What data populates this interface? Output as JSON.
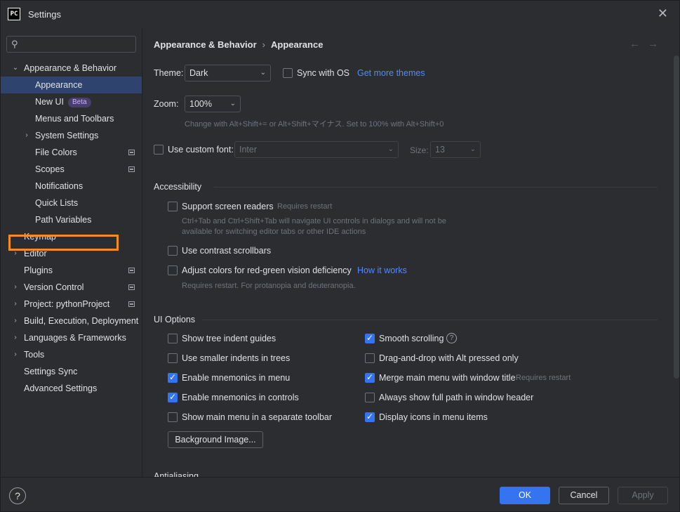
{
  "window": {
    "title": "Settings",
    "app_icon": "PC"
  },
  "search": {
    "placeholder": ""
  },
  "tree": [
    {
      "label": "Appearance & Behavior",
      "expanded": true
    },
    {
      "label": "Appearance",
      "selected": true
    },
    {
      "label": "New UI",
      "badge": "Beta"
    },
    {
      "label": "Menus and Toolbars"
    },
    {
      "label": "System Settings"
    },
    {
      "label": "File Colors"
    },
    {
      "label": "Scopes"
    },
    {
      "label": "Notifications"
    },
    {
      "label": "Quick Lists"
    },
    {
      "label": "Path Variables"
    },
    {
      "label": "Keymap"
    },
    {
      "label": "Editor"
    },
    {
      "label": "Plugins",
      "highlighted": true
    },
    {
      "label": "Version Control"
    },
    {
      "label": "Project: pythonProject"
    },
    {
      "label": "Build, Execution, Deployment"
    },
    {
      "label": "Languages & Frameworks"
    },
    {
      "label": "Tools"
    },
    {
      "label": "Settings Sync"
    },
    {
      "label": "Advanced Settings"
    }
  ],
  "breadcrumb": {
    "parent": "Appearance & Behavior",
    "sep": "›",
    "current": "Appearance"
  },
  "nav": {
    "back": "←",
    "forward": "→"
  },
  "theme": {
    "label": "Theme:",
    "value": "Dark",
    "sync_label": "Sync with OS",
    "sync_checked": false,
    "more_link": "Get more themes"
  },
  "zoom": {
    "label": "Zoom:",
    "value": "100%",
    "hint": "Change with Alt+Shift+= or Alt+Shift+マイナス. Set to 100% with Alt+Shift+0"
  },
  "font": {
    "checkbox_label": "Use custom font:",
    "checked": false,
    "value": "Inter",
    "size_label": "Size:",
    "size_value": "13"
  },
  "accessibility": {
    "title": "Accessibility",
    "screen_readers": {
      "label": "Support screen readers",
      "note": "Requires restart",
      "desc1": "Ctrl+Tab and Ctrl+Shift+Tab will navigate UI controls in dialogs and will not be",
      "desc2": "available for switching editor tabs or other IDE actions",
      "checked": false
    },
    "contrast": {
      "label": "Use contrast scrollbars",
      "checked": false
    },
    "color_def": {
      "label": "Adjust colors for red-green vision deficiency",
      "link": "How it works",
      "desc": "Requires restart. For protanopia and deuteranopia.",
      "checked": false
    }
  },
  "ui_options": {
    "title": "UI Options",
    "left": [
      {
        "label": "Show tree indent guides",
        "checked": false
      },
      {
        "label": "Use smaller indents in trees",
        "checked": false
      },
      {
        "label": "Enable mnemonics in menu",
        "checked": true
      },
      {
        "label": "Enable mnemonics in controls",
        "checked": true
      },
      {
        "label": "Show main menu in a separate toolbar",
        "checked": false
      }
    ],
    "right": [
      {
        "label": "Smooth scrolling",
        "checked": true
      },
      {
        "label": "Drag-and-drop with Alt pressed only",
        "checked": false
      },
      {
        "label": "Merge main menu with window title",
        "note": "Requires restart",
        "checked": true
      },
      {
        "label": "Always show full path in window header",
        "checked": false
      },
      {
        "label": "Display icons in menu items",
        "checked": true
      }
    ],
    "background_button": "Background Image..."
  },
  "antialiasing": {
    "title": "Antialiasing"
  },
  "footer": {
    "help": "?",
    "ok": "OK",
    "cancel": "Cancel",
    "apply": "Apply"
  },
  "icons": {
    "search": "search-icon",
    "close": "close-icon",
    "chevron": "chevron-down-icon",
    "help": "help-icon"
  },
  "colors": {
    "accent": "#3574f0",
    "link": "#548af7",
    "selection": "#2e436e",
    "highlight": "#f68c1f",
    "background": "#2b2d30"
  }
}
